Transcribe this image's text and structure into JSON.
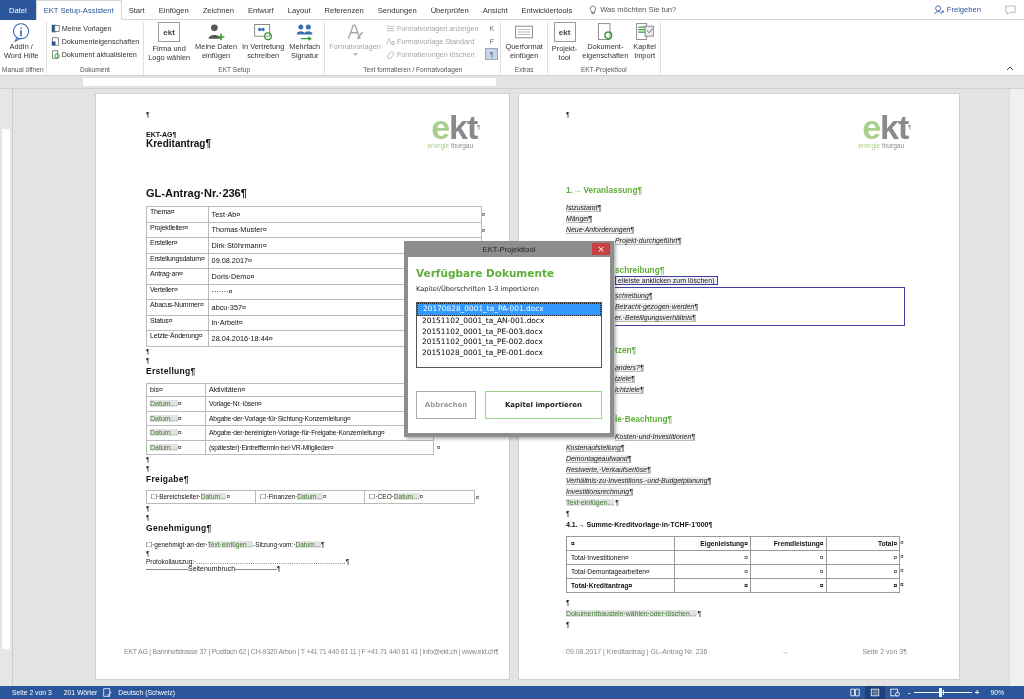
{
  "ribbon_tabs": [
    {
      "label": "Datei",
      "kind": "file",
      "selected": false
    },
    {
      "label": "EKT Setup-Assistent",
      "kind": "tab",
      "selected": true
    },
    {
      "label": "Start",
      "kind": "tab",
      "selected": false
    },
    {
      "label": "Einfügen",
      "kind": "tab",
      "selected": false
    },
    {
      "label": "Zeichnen",
      "kind": "tab",
      "selected": false
    },
    {
      "label": "Entwurf",
      "kind": "tab",
      "selected": false
    },
    {
      "label": "Layout",
      "kind": "tab",
      "selected": false
    },
    {
      "label": "Referenzen",
      "kind": "tab",
      "selected": false
    },
    {
      "label": "Sendungen",
      "kind": "tab",
      "selected": false
    },
    {
      "label": "Überprüfen",
      "kind": "tab",
      "selected": false
    },
    {
      "label": "Ansicht",
      "kind": "tab",
      "selected": false
    },
    {
      "label": "Entwicklertools",
      "kind": "tab",
      "selected": false
    }
  ],
  "tell_me": {
    "placeholder": "Was möchten Sie tun?"
  },
  "share": {
    "label": "Freigeben"
  },
  "ribbon_groups": [
    {
      "label": "Manual öffnen",
      "items": [
        {
          "kind": "large",
          "label": "AddIn /\nWord Hilfe",
          "disabled": false
        }
      ]
    },
    {
      "label": "Dokument",
      "items": [
        {
          "kind": "small",
          "label": "Meine Vorlagen",
          "disabled": false
        },
        {
          "kind": "small",
          "label": "Dokumenteigenschaften",
          "disabled": false
        },
        {
          "kind": "small",
          "label": "Dokument aktualisieren",
          "disabled": false
        }
      ]
    },
    {
      "label": "EKT Setup",
      "items": [
        {
          "kind": "large",
          "label": "Firma und\nLogo wählen",
          "badge": "ekt",
          "disabled": false
        },
        {
          "kind": "large",
          "label": "Meine Daten\neinfügen",
          "disabled": false
        },
        {
          "kind": "large",
          "label": "In Vertretung\nschreiben",
          "disabled": false
        },
        {
          "kind": "large",
          "label": "Mehrfach\nSignatur",
          "disabled": false
        }
      ]
    },
    {
      "label": "Text formatieren / Formatvorlagen",
      "items": [
        {
          "kind": "large",
          "label": "Formatvorlagen",
          "dropdown": true,
          "disabled": true
        },
        {
          "kind": "small",
          "label": "Formatvorlagen anzeigen",
          "disabled": true
        },
        {
          "kind": "small",
          "label": "Formatvorlage Standard",
          "disabled": true
        },
        {
          "kind": "small",
          "label": "Formatierungen löschen",
          "disabled": true
        },
        {
          "kind": "toggle",
          "label": "K",
          "selected": false
        },
        {
          "kind": "toggle",
          "label": "F",
          "selected": false
        },
        {
          "kind": "toggle",
          "label": "¶",
          "selected": true
        }
      ]
    },
    {
      "label": "Extras",
      "items": [
        {
          "kind": "large",
          "label": "Querformat\neinfügen",
          "disabled": false
        }
      ]
    },
    {
      "label": "EKT-Projekttool",
      "items": [
        {
          "kind": "large",
          "label": "Projekt-\ntool",
          "badge": "ekt",
          "disabled": false
        },
        {
          "kind": "large",
          "label": "Dokument-\neigenschaften",
          "disabled": false
        },
        {
          "kind": "large",
          "label": "Kapitel\nImport",
          "disabled": false
        }
      ]
    }
  ],
  "left_page": {
    "top_mark": "¶",
    "company": "EKT-AG¶",
    "doc_title": "Kreditantrag¶",
    "logo": {
      "green": "e",
      "gray": "kt",
      "mark": "¶",
      "tagline_green": "energie",
      "tagline_gray": "thurgau"
    },
    "blocks": [
      {
        "kind": "title",
        "text": "GL-Antrag·Nr.·236¶"
      },
      {
        "kind": "info_table",
        "rows": [
          {
            "label": "Thema¤",
            "value": "Test·Ab¤",
            "end": "¤"
          },
          {
            "label": "Projektleiter¤",
            "value": "Thomas·Muster¤",
            "end": "¤"
          },
          {
            "label": "Ersteller¤",
            "value": "Dirk·Stöhrmann¤"
          },
          {
            "label": "Erstellungsdatum¤",
            "value": "09.08.2017¤"
          },
          {
            "label": "Antrag·an¤",
            "value": "Doris·Demo¤"
          },
          {
            "label": "Verteiler¤",
            "value": "·······¤"
          },
          {
            "label": "Abacus-Nummer¤",
            "value": "abcu·357¤"
          },
          {
            "label": "Status¤",
            "value": "in·Arbeit¤"
          },
          {
            "label": "Letzte·Änderung¤",
            "value": "28.04.2016·18:44¤"
          }
        ]
      },
      {
        "kind": "mark",
        "text": "¶"
      },
      {
        "kind": "mark",
        "text": "¶"
      },
      {
        "kind": "heading",
        "text": "Erstellung¶"
      },
      {
        "kind": "activity_table",
        "header": [
          "bis¤",
          "Aktivitäten¤"
        ],
        "rows": [
          {
            "date": "Datum…",
            "date_end": "¤",
            "activity": "Vorlage·Nr.·lösen¤"
          },
          {
            "date": "Datum…",
            "date_end": "¤",
            "activity": "Abgabe·der·Vorlage·für·Sichtung·Konzernleitung¤"
          },
          {
            "date": "Datum…",
            "date_end": "¤",
            "activity": "Abgabe·der·bereinigten·Vorlage·für·Freigabe·Konzernleitung¤"
          },
          {
            "date": "Datum…",
            "date_end": "¤",
            "activity": "(spätester)·Eintrefftermin·bei·VR-Mitglieder¤",
            "extra": "¤"
          }
        ]
      },
      {
        "kind": "mark",
        "text": "¶"
      },
      {
        "kind": "mark",
        "text": "¶"
      },
      {
        "kind": "heading",
        "text": "Freigabe¶"
      },
      {
        "kind": "approval_table",
        "end": "¤",
        "cells": [
          [
            {
              "text": "☐·Bereichsleiter·",
              "placeholder": false
            },
            {
              "text": "Datum…",
              "placeholder": true
            },
            {
              "text": "¤",
              "placeholder": false
            }
          ],
          [
            {
              "text": "☐·Finanzen·",
              "placeholder": false
            },
            {
              "text": "Datum…",
              "placeholder": true
            },
            {
              "text": "¤",
              "placeholder": false
            }
          ],
          [
            {
              "text": "☐·CEO·",
              "placeholder": false
            },
            {
              "text": "Datum…",
              "placeholder": true
            },
            {
              "text": "¤",
              "placeholder": false
            }
          ]
        ]
      },
      {
        "kind": "mark",
        "text": "¶"
      },
      {
        "kind": "mark",
        "text": "¶"
      },
      {
        "kind": "heading",
        "text": "Genehmigung¶"
      },
      {
        "kind": "line",
        "segments": [
          {
            "text": "☐·genehmigt·an·der·",
            "placeholder": false
          },
          {
            "text": "Text·einfügen…",
            "placeholder": true
          },
          {
            "text": "-Sitzung·vom:·",
            "placeholder": false
          },
          {
            "text": "Datum…",
            "placeholder": true
          },
          {
            "text": "¶",
            "placeholder": false
          }
        ]
      },
      {
        "kind": "mark",
        "text": "¶"
      },
      {
        "kind": "text",
        "text": "Protokollauszug:·……………………………………………………………¶"
      },
      {
        "kind": "pagebreak",
        "text": "——————Seitenumbruch——————¶"
      }
    ],
    "footer": "EKT AG | Bahnhofstrasse 37 | Postfach 62 | CH-9320 Arbon | T +41 71 440 61 11 | F +41 71 440 61 41 | info@ekt.ch | www.ekt.ch¶"
  },
  "right_page": {
    "top_mark": "¶",
    "logo": {
      "green": "e",
      "gray": "kt",
      "mark": "¶",
      "tagline_green": "energie",
      "tagline_gray": "thurgau"
    },
    "blocks": [
      {
        "kind": "heading",
        "text": "1.→ Veranlassung¶"
      },
      {
        "kind": "item",
        "text": "Istzustand¶"
      },
      {
        "kind": "item",
        "text": "Mängel¶"
      },
      {
        "kind": "item",
        "text": "Neue·Anforderungen¶"
      },
      {
        "kind": "item",
        "text": "Projekt·durchgeführt¶",
        "partial": true
      },
      {
        "kind": "heading",
        "text": "schreibung¶",
        "partial": true
      },
      {
        "kind": "hint",
        "text": "elleiste anklicken zum löschen)",
        "partial": true
      },
      {
        "kind": "box",
        "partial": true,
        "items": [
          "schreibung¶",
          "Betracht·gezogen·werden¶",
          "er.·Beteiligungsverhältnis¶"
        ]
      },
      {
        "kind": "heading",
        "text": "tzen¶",
        "partial": true
      },
      {
        "kind": "item",
        "text": "anders?¶",
        "partial": true
      },
      {
        "kind": "item",
        "text": "tziele¶",
        "partial": true
      },
      {
        "kind": "item",
        "text": "ichtziele¶",
        "partial": true
      },
      {
        "kind": "heading",
        "text": "le·Beachtung¶",
        "partial": true
      },
      {
        "kind": "item",
        "text": "Kosten·und·Investitionen¶",
        "partial": true
      },
      {
        "kind": "item",
        "text": "Kostenaufstellung¶"
      },
      {
        "kind": "item",
        "text": "Demontageaufwand¶"
      },
      {
        "kind": "item",
        "text": "Restwerte,·Verkaufserlöse¶"
      },
      {
        "kind": "item",
        "text": "Verhältnis·zu·Investitions-·und·Budgetplanung¶"
      },
      {
        "kind": "item",
        "text": "Investitionsrechnung¶"
      },
      {
        "kind": "placeholder",
        "text": "Text·einfügen…",
        "end": "¶"
      },
      {
        "kind": "mark",
        "text": "¶"
      },
      {
        "kind": "subheading",
        "text": "4.1.→ Summe·Kreditvorlage·in·TCHF·1'000¶"
      },
      {
        "kind": "table",
        "header": [
          "¤",
          "Eigenleistung¤",
          "Fremdleistung¤",
          "Total¤"
        ],
        "header_end": "¤",
        "rows": [
          {
            "cells": [
              "Total·Investitionen¤",
              "¤",
              "¤",
              "¤"
            ],
            "end": "¤",
            "bold": false
          },
          {
            "cells": [
              "Total·Demontagearbeiten¤",
              "¤",
              "¤",
              "¤"
            ],
            "end": "¤",
            "bold": false
          },
          {
            "cells": [
              "Total·Kreditantrag¤",
              "¤",
              "¤",
              "¤"
            ],
            "end": "¤",
            "bold": true
          }
        ]
      },
      {
        "kind": "mark",
        "text": "¶"
      },
      {
        "kind": "placeholder",
        "text": "Dokumentbaustein·wählen·oder·löschen…",
        "end": "¶"
      },
      {
        "kind": "mark",
        "text": "¶"
      }
    ],
    "footer": {
      "left": "09.08.2017 | Kreditantrag | GL-Antrag Nr. 236",
      "center": "→",
      "right": "Seite 2 von 3¶"
    }
  },
  "dialog": {
    "title": "EKT-Projekttool",
    "close": "×",
    "heading": "Verfügbare Dokumente",
    "subtitle": "Kapitel/Überschriften 1-3 importieren",
    "files": [
      {
        "name": "20170828_0001_ta_PA-001.docx",
        "selected": true
      },
      {
        "name": "20151102_0001_ta_AN-001.docx",
        "selected": false
      },
      {
        "name": "20151102_0001_ta_PE-003.docx",
        "selected": false
      },
      {
        "name": "20151102_0001_ta_PE-002.docx",
        "selected": false
      },
      {
        "name": "20151028_0001_ta_PE-001.docx",
        "selected": false
      }
    ],
    "buttons": [
      {
        "label": "Abbrechen",
        "disabled": true
      },
      {
        "label": "Kapitel importieren",
        "disabled": false
      }
    ]
  },
  "status_bar": {
    "page": "Seite 2 von 3",
    "words": "201 Wörter",
    "language": "Deutsch (Schweiz)",
    "views": [
      {
        "selected": false
      },
      {
        "selected": true
      },
      {
        "selected": false
      }
    ],
    "zoom_out": "-",
    "zoom_in": "+",
    "zoom": {
      "level": 0.45
    },
    "zoom_label": "90%"
  }
}
